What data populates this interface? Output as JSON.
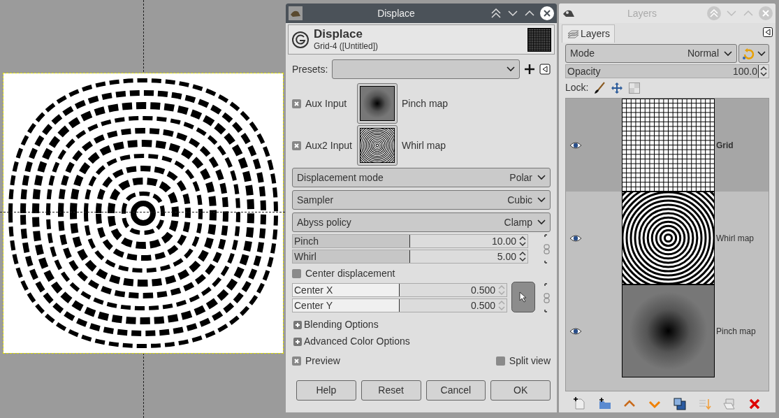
{
  "dialog": {
    "title": "Displace",
    "header": {
      "name": "Displace",
      "subtitle": "Grid-4 ([Untitled])"
    },
    "presets": {
      "label": "Presets:"
    },
    "aux_inputs": [
      {
        "label": "Aux Input",
        "checked": true,
        "map": "Pinch map",
        "kind": "pinch"
      },
      {
        "label": "Aux2 Input",
        "checked": true,
        "map": "Whirl map",
        "kind": "whirl"
      }
    ],
    "dropdowns": [
      {
        "label": "Displacement mode",
        "value": "Polar"
      },
      {
        "label": "Sampler",
        "value": "Cubic"
      },
      {
        "label": "Abyss policy",
        "value": "Clamp"
      }
    ],
    "sliders": [
      {
        "label": "Pinch",
        "value": "10.00",
        "level": 0.5
      },
      {
        "label": "Whirl",
        "value": "5.00",
        "level": 0.5
      }
    ],
    "center_displacement": {
      "label": "Center displacement",
      "checked": false
    },
    "center": [
      {
        "label": "Center X",
        "value": "0.500",
        "level": 0.5
      },
      {
        "label": "Center Y",
        "value": "0.500",
        "level": 0.5
      }
    ],
    "expanders": [
      {
        "label": "Blending Options",
        "expanded": false
      },
      {
        "label": "Advanced Color Options",
        "expanded": false
      }
    ],
    "preview": {
      "label": "Preview",
      "checked": true
    },
    "split_view": {
      "label": "Split view",
      "checked": false
    },
    "buttons": [
      "Help",
      "Reset",
      "Cancel",
      "OK"
    ]
  },
  "layers_window": {
    "title": "Layers",
    "tab": "Layers",
    "mode": {
      "label": "Mode",
      "value": "Normal"
    },
    "opacity": {
      "label": "Opacity",
      "value": "100.0",
      "level": 1.0
    },
    "lock": {
      "label": "Lock:"
    },
    "layers": [
      {
        "name": "Grid",
        "selected": true,
        "visible": true,
        "kind": "grid"
      },
      {
        "name": "Whirl map",
        "selected": false,
        "visible": true,
        "kind": "whirl"
      },
      {
        "name": "Pinch map",
        "selected": false,
        "visible": true,
        "kind": "pinch"
      }
    ]
  }
}
